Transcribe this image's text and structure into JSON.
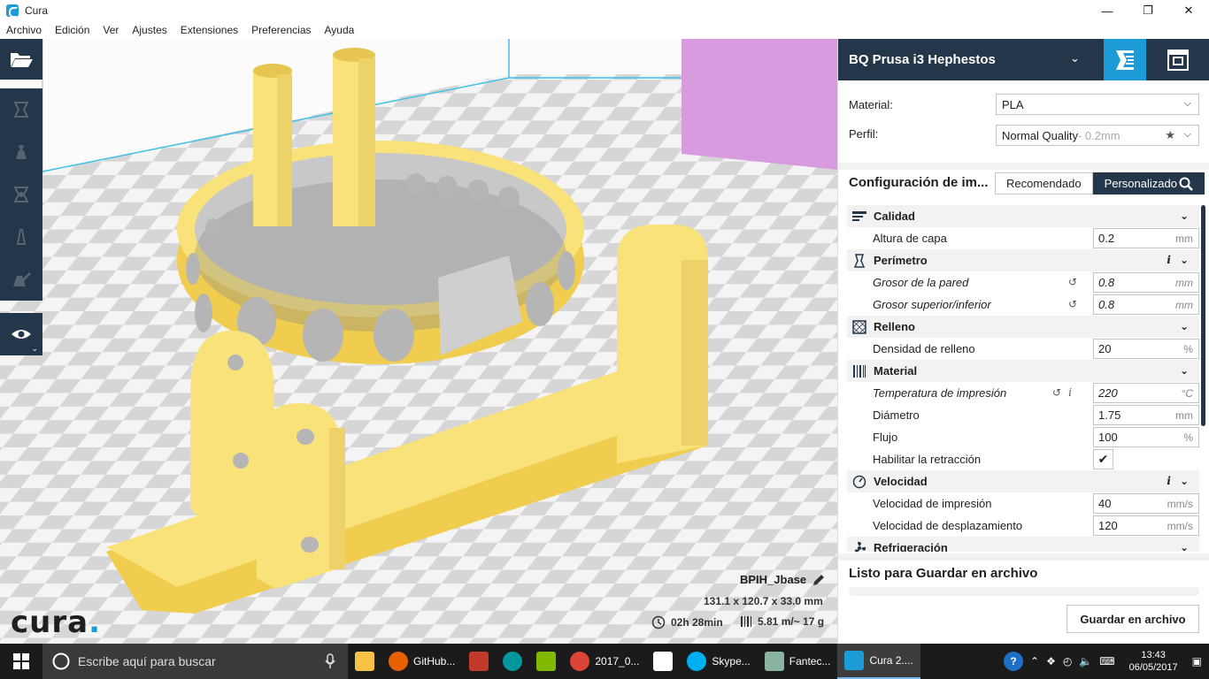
{
  "window": {
    "title": "Cura"
  },
  "menu": [
    "Archivo",
    "Edición",
    "Ver",
    "Ajustes",
    "Extensiones",
    "Preferencias",
    "Ayuda"
  ],
  "logo": {
    "text": "cura",
    "dot": "."
  },
  "job": {
    "name": "BPIH_Jbase",
    "dimensions": "131.1 x 120.7 x 33.0 mm",
    "time": "02h 28min",
    "material": "5.81 m/~ 17 g"
  },
  "panel": {
    "printer": "BQ Prusa i3 Hephestos",
    "material_label": "Material:",
    "material_value": "PLA",
    "profile_label": "Perfil:",
    "profile_value": "Normal Quality",
    "profile_suffix": " - 0.2mm",
    "config_title": "Configuración de im...",
    "tab_recommended": "Recomendado",
    "tab_custom": "Personalizado",
    "ready_text": "Listo para Guardar en archivo",
    "save_button": "Guardar en archivo"
  },
  "settings": {
    "quality": {
      "label": "Calidad",
      "layer_height": {
        "label": "Altura de capa",
        "value": "0.2",
        "unit": "mm"
      }
    },
    "perimeter": {
      "label": "Perímetro",
      "wall_thickness": {
        "label": "Grosor de la pared",
        "value": "0.8",
        "unit": "mm"
      },
      "top_bottom": {
        "label": "Grosor superior/inferior",
        "value": "0.8",
        "unit": "mm"
      }
    },
    "infill": {
      "label": "Relleno",
      "density": {
        "label": "Densidad de relleno",
        "value": "20",
        "unit": "%"
      }
    },
    "material": {
      "label": "Material",
      "temperature": {
        "label": "Temperatura de impresión",
        "value": "220",
        "unit": "°C"
      },
      "diameter": {
        "label": "Diámetro",
        "value": "1.75",
        "unit": "mm"
      },
      "flow": {
        "label": "Flujo",
        "value": "100",
        "unit": "%"
      },
      "retraction": {
        "label": "Habilitar la retracción",
        "checked": "✔"
      }
    },
    "speed": {
      "label": "Velocidad",
      "print_speed": {
        "label": "Velocidad de impresión",
        "value": "40",
        "unit": "mm/s"
      },
      "travel_speed": {
        "label": "Velocidad de desplazamiento",
        "value": "120",
        "unit": "mm/s"
      }
    },
    "cooling": {
      "label": "Refrigeración"
    }
  },
  "taskbar": {
    "search_placeholder": "Escribe aquí para buscar",
    "apps": [
      {
        "label": "GitHub..."
      },
      {
        "label": "2017_0..."
      },
      {
        "label": "Skype..."
      },
      {
        "label": "Fantec..."
      },
      {
        "label": "Cura 2...."
      }
    ],
    "time": "13:43",
    "date": "06/05/2017"
  },
  "colors": {
    "accent": "#1d9bd7",
    "dark": "#243649",
    "model": "#f9e27a"
  }
}
